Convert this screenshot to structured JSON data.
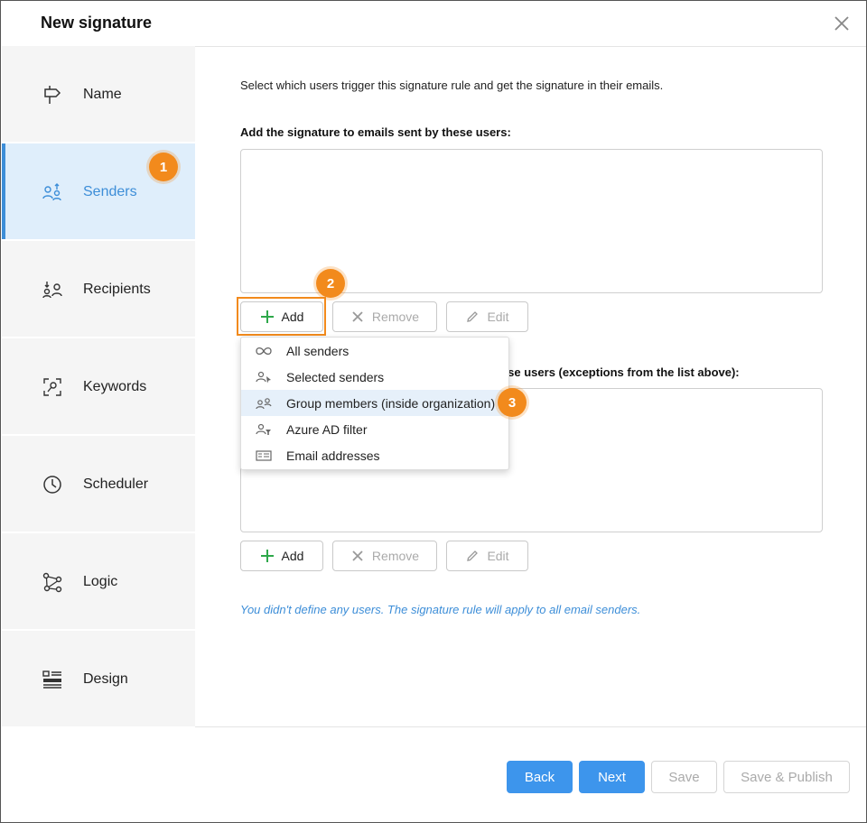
{
  "dialog": {
    "title": "New signature"
  },
  "sidebar": {
    "items": [
      {
        "label": "Name",
        "icon": "signpost-icon"
      },
      {
        "label": "Senders",
        "icon": "senders-icon"
      },
      {
        "label": "Recipients",
        "icon": "recipients-icon"
      },
      {
        "label": "Keywords",
        "icon": "keywords-icon"
      },
      {
        "label": "Scheduler",
        "icon": "clock-icon"
      },
      {
        "label": "Logic",
        "icon": "logic-icon"
      },
      {
        "label": "Design",
        "icon": "design-icon"
      }
    ],
    "active_item": "Senders"
  },
  "main": {
    "intro": "Select which users trigger this signature rule and get the signature in their emails.",
    "include_label": "Add the signature to emails sent by these users:",
    "exclude_label_visible": "hese users (exceptions from the list above):",
    "buttons": {
      "add": "Add",
      "remove": "Remove",
      "edit": "Edit"
    },
    "note": "You didn't define any users. The signature rule will apply to all email senders."
  },
  "dropdown": {
    "items": [
      {
        "label": "All senders",
        "icon": "infinity-icon"
      },
      {
        "label": "Selected senders",
        "icon": "user-cursor-icon"
      },
      {
        "label": "Group members (inside organization)",
        "icon": "group-icon"
      },
      {
        "label": "Azure AD filter",
        "icon": "user-filter-icon"
      },
      {
        "label": "Email addresses",
        "icon": "email-card-icon"
      }
    ],
    "hovered_item": "Group members (inside organization)"
  },
  "badges": [
    "1",
    "2",
    "3"
  ],
  "footer": {
    "back": "Back",
    "next": "Next",
    "save": "Save",
    "save_publish": "Save & Publish"
  },
  "colors": {
    "accent": "#3d95ec",
    "highlight": "#f28a1c",
    "active_bg": "#dfeefb",
    "note": "#3d8ed8"
  }
}
